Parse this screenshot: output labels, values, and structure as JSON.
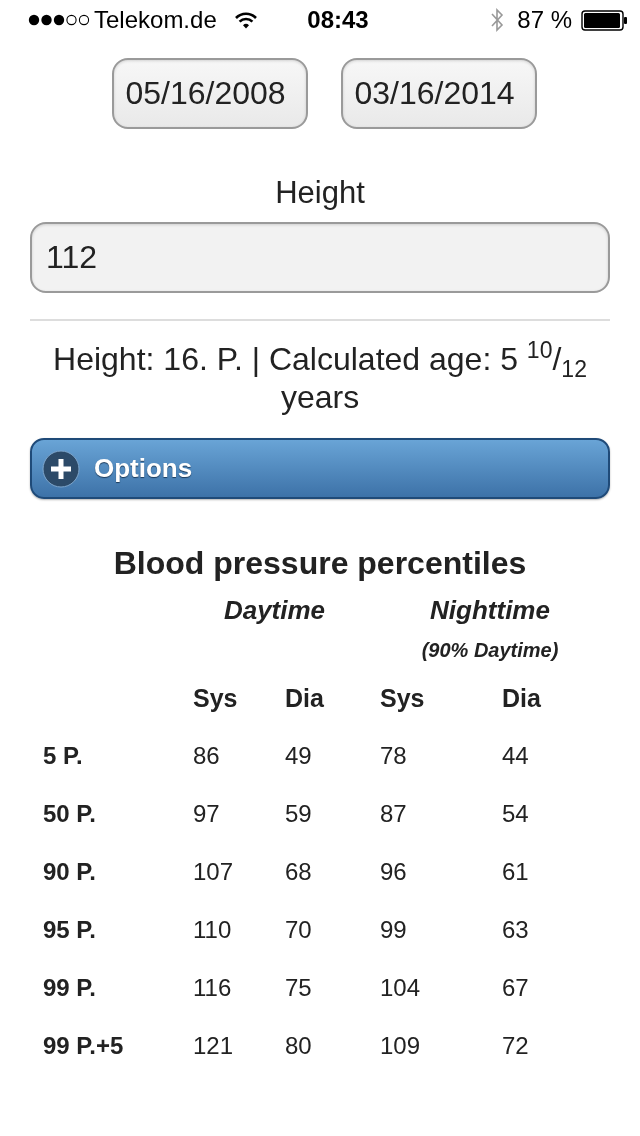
{
  "status_bar": {
    "carrier": "Telekom.de",
    "time": "08:43",
    "battery": "87 %"
  },
  "date_range": {
    "start": "05/16/2008",
    "end": "03/16/2014"
  },
  "height_field": {
    "label": "Height",
    "value": "112"
  },
  "summary": "Height: 16. P. | Calculated age: 5 $^{10}$/$_{12}$ years",
  "options_button": {
    "label": "Options",
    "expanded": false
  },
  "percentiles": {
    "title": "Blood pressure percentiles",
    "groups": [
      {
        "label": "Daytime"
      },
      {
        "label": "Nighttime",
        "note": "(90% Daytime)"
      }
    ],
    "columns": [
      "Sys",
      "Dia",
      "Sys",
      "Dia"
    ],
    "rows": [
      {
        "label": "5 P.",
        "values": [
          "86",
          "49",
          "78",
          "44"
        ]
      },
      {
        "label": "50 P.",
        "values": [
          "97",
          "59",
          "87",
          "54"
        ]
      },
      {
        "label": "90 P.",
        "values": [
          "107",
          "68",
          "96",
          "61"
        ]
      },
      {
        "label": "95 P.",
        "values": [
          "110",
          "70",
          "99",
          "63"
        ]
      },
      {
        "label": "99 P.",
        "values": [
          "116",
          "75",
          "104",
          "67"
        ]
      },
      {
        "label": "99 P.+5",
        "values": [
          "121",
          "80",
          "109",
          "72"
        ]
      }
    ]
  }
}
